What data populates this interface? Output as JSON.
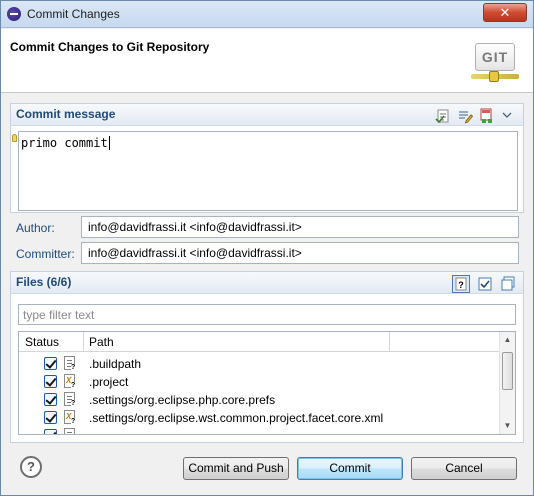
{
  "window": {
    "title": "Commit Changes",
    "close_label": "✕"
  },
  "header": {
    "heading": "Commit Changes to Git Repository",
    "logo_text": "GIT"
  },
  "commit_message": {
    "section_label": "Commit message",
    "text": "primo commit",
    "toolbar_icons": [
      "spell-check-icon",
      "edit-icon",
      "signed-off-icon",
      "menu-chevron-icon"
    ]
  },
  "author": {
    "label": "Author:",
    "value": "info@davidfrassi.it <info@davidfrassi.it>"
  },
  "committer": {
    "label": "Committer:",
    "value": "info@davidfrassi.it <info@davidfrassi.it>"
  },
  "files": {
    "section_label": "Files (6/6)",
    "filter_placeholder": "type filter text",
    "columns": [
      "Status",
      "Path"
    ],
    "rows": [
      {
        "path": ".buildpath",
        "checked": true,
        "icon": "unversioned-file-icon"
      },
      {
        "path": ".project",
        "checked": true,
        "icon": "xml-file-icon"
      },
      {
        "path": ".settings/org.eclipse.php.core.prefs",
        "checked": true,
        "icon": "unversioned-file-icon"
      },
      {
        "path": ".settings/org.eclipse.wst.common.project.facet.core.xml",
        "checked": true,
        "icon": "xml-file-icon"
      }
    ],
    "toolbar_icons": [
      "show-untracked-icon",
      "select-all-icon",
      "deselect-all-icon"
    ]
  },
  "footer": {
    "help_label": "?",
    "commit_and_push_label": "Commit and Push",
    "commit_label": "Commit",
    "cancel_label": "Cancel"
  }
}
